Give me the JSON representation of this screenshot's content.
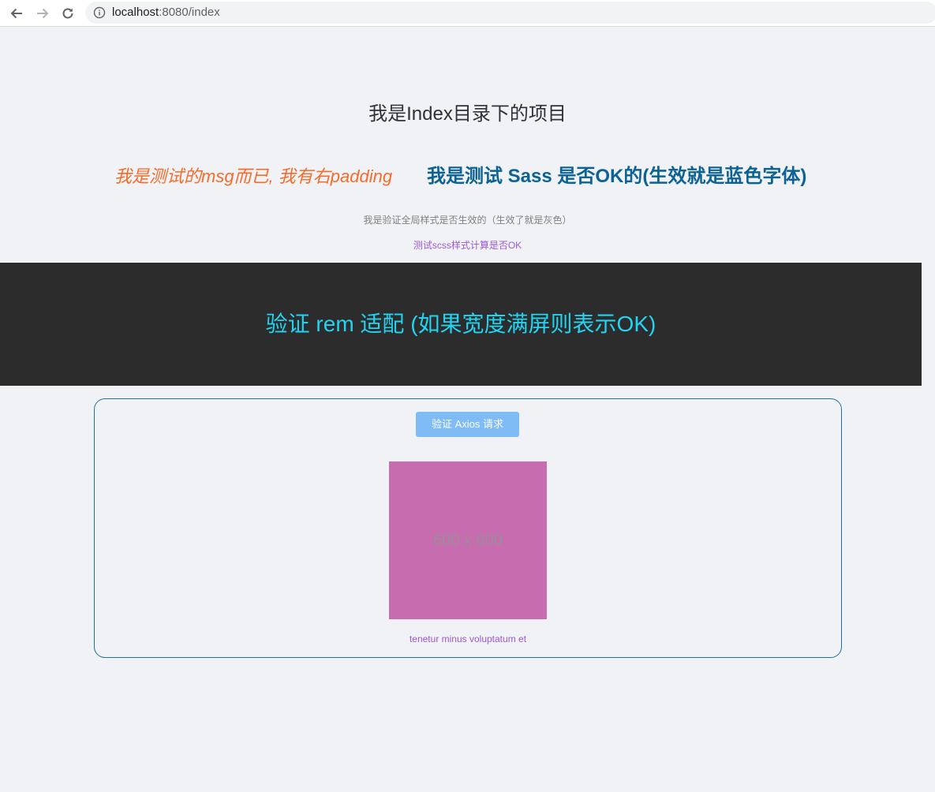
{
  "browser": {
    "url_host": "localhost",
    "url_rest": ":8080/index",
    "icons": {
      "back": "arrow-left-icon",
      "forward": "arrow-right-icon",
      "reload": "reload-icon",
      "site_info": "info-icon"
    }
  },
  "page": {
    "title": "我是Index目录下的项目",
    "msg_italic": "我是测试的msg而已, 我有右padding",
    "sass_title": "我是测试 Sass 是否OK的(生效就是蓝色字体)",
    "global_style_text": "我是验证全局样式是否生效的（生效了就是灰色）",
    "scss_calc_text": "测试scss样式计算是否OK",
    "rem_banner_text": "验证 rem 适配 (如果宽度满屏则表示OK)",
    "card": {
      "axios_button_label": "验证 Axios 请求",
      "image_label": "600 x 600",
      "caption": "tenetur minus voluptatum et"
    }
  },
  "colors": {
    "page_background": "#f0f2f5",
    "italic_orange": "#f56c2a",
    "sass_blue": "#0c6294",
    "gray_text": "#808080",
    "purple_text": "#9b59d6",
    "banner_background": "#2c2c2c",
    "banner_cyan": "#22d4f2",
    "button_blue": "#7fbcf6",
    "image_pink": "#c66caf"
  }
}
